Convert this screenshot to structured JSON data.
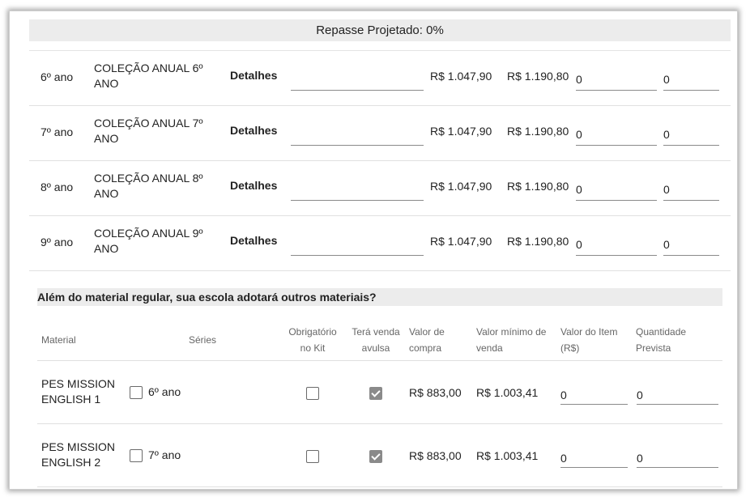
{
  "banner": {
    "text": "Repasse Projetado: 0%"
  },
  "kits": [
    {
      "serie": "6º ano",
      "colecao": "COLEÇÃO ANUAL 6º ANO",
      "detalhes": "Detalhes",
      "obs": "",
      "compra": "R$ 1.047,90",
      "venda": "R$ 1.190,80",
      "valor1": "0",
      "valor2": "0"
    },
    {
      "serie": "7º ano",
      "colecao": "COLEÇÃO ANUAL 7º ANO",
      "detalhes": "Detalhes",
      "obs": "",
      "compra": "R$ 1.047,90",
      "venda": "R$ 1.190,80",
      "valor1": "0",
      "valor2": "0"
    },
    {
      "serie": "8º ano",
      "colecao": "COLEÇÃO ANUAL 8º ANO",
      "detalhes": "Detalhes",
      "obs": "",
      "compra": "R$ 1.047,90",
      "venda": "R$ 1.190,80",
      "valor1": "0",
      "valor2": "0"
    },
    {
      "serie": "9º ano",
      "colecao": "COLEÇÃO ANUAL 9º ANO",
      "detalhes": "Detalhes",
      "obs": "",
      "compra": "R$ 1.047,90",
      "venda": "R$ 1.190,80",
      "valor1": "0",
      "valor2": "0"
    }
  ],
  "section": {
    "title": "Além do material regular, sua escola adotará outros materiais?"
  },
  "headers": {
    "material": "Material",
    "series": "Séries",
    "obrigatorio": "Obrigatório no Kit",
    "avulsa": "Terá venda avulsa",
    "compra": "Valor de compra",
    "venda_min": "Valor mínimo de venda",
    "valor_item": "Valor do Item (R$)",
    "quantidade": "Quantidade Prevista"
  },
  "materials": [
    {
      "nome": "PES MISSION ENGLISH 1",
      "serie": "6º ano",
      "serie_checked": false,
      "obrigatorio": false,
      "avulsa": true,
      "compra": "R$ 883,00",
      "venda_min": "R$ 1.003,41",
      "valor_item": "0",
      "quantidade": "0"
    },
    {
      "nome": "PES MISSION ENGLISH 2",
      "serie": "7º ano",
      "serie_checked": false,
      "obrigatorio": false,
      "avulsa": true,
      "compra": "R$ 883,00",
      "venda_min": "R$ 1.003,41",
      "valor_item": "0",
      "quantidade": "0"
    }
  ],
  "colors": {
    "section_bg": "#ececec",
    "checkbox_checked": "#8a8a8a"
  }
}
